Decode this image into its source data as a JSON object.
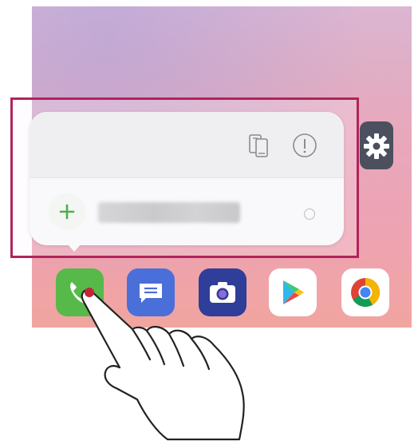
{
  "popup": {
    "top_actions": [
      {
        "icon": "widget-swap-icon"
      },
      {
        "icon": "info-icon"
      }
    ],
    "shortcut": {
      "add_icon": "plus-icon",
      "label": ""
    }
  },
  "dock": {
    "apps": [
      {
        "icon": "phone-icon",
        "color": "#56b949"
      },
      {
        "icon": "messages-icon",
        "color": "#4a6fd9"
      },
      {
        "icon": "camera-icon",
        "color": "#2f3e98"
      },
      {
        "icon": "play-store-icon",
        "color": "#ffffff"
      },
      {
        "icon": "chrome-icon",
        "color": "#ffffff"
      }
    ]
  },
  "colors": {
    "highlight_border": "#b0245a",
    "plus_green": "#4caf50"
  }
}
